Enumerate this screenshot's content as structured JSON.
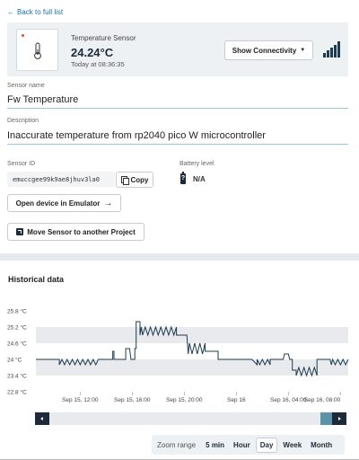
{
  "back_link": {
    "label": "Back to full list"
  },
  "sensor": {
    "type": "Temperature Sensor",
    "value": "24.24°C",
    "timestamp": "Today at 08:36:35",
    "connectivity_button": "Show Connectivity",
    "signal_icon": "signal-strength-icon",
    "thermometer_icon": "thermometer-icon",
    "status_dot_color": "#e24b3b"
  },
  "fields": {
    "name_label": "Sensor name",
    "name_value": "Fw Temperature",
    "description_label": "Description",
    "description_value": "Inaccurate temperature from rp2040 pico W microcontroller",
    "id_label": "Sensor ID",
    "id_value": "emuccgee99k9ae8jhuv3la0",
    "copy_button": "Copy",
    "battery_label": "Battery level",
    "battery_value": "N/A"
  },
  "actions": {
    "emulator_button": "Open device in Emulator",
    "move_button": "Move Sensor to another Project"
  },
  "historical": {
    "title": "Historical data",
    "zoom_label": "Zoom range",
    "zoom_options": [
      "5 min",
      "Hour",
      "Day",
      "Week",
      "Month"
    ],
    "zoom_selected": "Day"
  },
  "colors": {
    "accent": "#1a73a8",
    "line": "#1d3c4f",
    "band": "#e8eaed",
    "scroll_thumb": "#5b93a8"
  },
  "chart_data": {
    "type": "line",
    "title": "",
    "xlabel": "",
    "ylabel": "",
    "y_ticks": [
      "25.8 °C",
      "25.2 °C",
      "24.6 °C",
      "24 °C",
      "23.4 °C",
      "22.8 °C"
    ],
    "y_tick_values": [
      25.8,
      25.2,
      24.6,
      24,
      23.4,
      22.8
    ],
    "ylim": [
      22.8,
      25.8
    ],
    "x_ticks": [
      "Sep 15, 12:00",
      "Sep 15, 16:00",
      "Sep 15, 20:00",
      "Sep 16",
      "Sep 16, 04:00",
      "Sep 16, 08:00"
    ],
    "x_tick_hours": [
      12,
      16,
      20,
      24,
      28,
      32
    ],
    "xlim_hours": [
      8.6,
      32.6
    ],
    "series": [
      {
        "x_hours": [
          8.6,
          10.4,
          10.4,
          10.6,
          10.8,
          11.0,
          11.2,
          11.4,
          11.6,
          11.8,
          12.0,
          12.2,
          12.4,
          12.6,
          12.8,
          13.0,
          13.2,
          13.4,
          13.5,
          14.5,
          14.5,
          14.6,
          14.6,
          15.5,
          15.5,
          15.8,
          15.9,
          16.2,
          16.2,
          16.3,
          16.3,
          16.6,
          16.6,
          16.7,
          16.8,
          17.0,
          17.2,
          17.4,
          17.6,
          17.8,
          18.0,
          18.2,
          18.4,
          18.6,
          18.8,
          19.0,
          19.2,
          19.4,
          19.4,
          20.2,
          20.3,
          20.4,
          20.6,
          20.8,
          21.0,
          21.2,
          21.4,
          21.6,
          21.6,
          22.6,
          22.6,
          22.7,
          22.8,
          23.0,
          23.2,
          23.4,
          23.6,
          23.8,
          24.0,
          24.2,
          24.4,
          24.6,
          24.8,
          25.0,
          25.2,
          25.2,
          25.6,
          25.6,
          25.8,
          26.0,
          26.2,
          26.4,
          26.6,
          26.6,
          27.6,
          27.6,
          27.7,
          28.0,
          28.1,
          28.3,
          28.3,
          28.6,
          28.6,
          28.8,
          29.0,
          29.2,
          29.4,
          29.6,
          29.8,
          30.0,
          30.2,
          30.2,
          31.2,
          31.3,
          31.4,
          31.6,
          31.8,
          32.0,
          32.2,
          32.4,
          32.6
        ],
        "y": [
          24.0,
          24.0,
          23.8,
          24.0,
          23.8,
          24.0,
          23.8,
          24.0,
          23.8,
          24.0,
          23.8,
          24.0,
          23.8,
          24.0,
          23.8,
          24.0,
          23.8,
          24.0,
          24.0,
          24.0,
          24.3,
          24.3,
          24.0,
          24.0,
          24.4,
          24.4,
          24.0,
          24.0,
          24.4,
          24.4,
          25.4,
          25.4,
          24.9,
          25.2,
          24.9,
          25.2,
          24.9,
          25.2,
          24.9,
          25.2,
          24.9,
          25.2,
          24.9,
          25.2,
          24.9,
          25.2,
          24.9,
          25.2,
          24.9,
          24.9,
          24.2,
          24.6,
          24.2,
          24.6,
          24.2,
          24.6,
          24.2,
          24.6,
          24.3,
          24.3,
          24.0,
          24.0,
          24.0,
          24.0,
          24.0,
          24.0,
          24.0,
          24.0,
          24.0,
          24.0,
          24.0,
          24.0,
          24.0,
          24.0,
          24.0,
          24.0,
          23.8,
          24.0,
          23.8,
          24.0,
          23.8,
          24.0,
          23.8,
          24.0,
          24.0,
          24.0,
          24.2,
          24.2,
          24.0,
          24.0,
          23.6,
          23.6,
          23.4,
          23.7,
          23.4,
          23.7,
          23.4,
          23.7,
          23.4,
          23.7,
          23.4,
          24.0,
          24.0,
          23.8,
          24.0,
          23.8,
          24.0,
          23.8,
          24.0,
          23.8,
          24.0
        ]
      }
    ],
    "grid": "alternating-bands",
    "legend": "none"
  }
}
